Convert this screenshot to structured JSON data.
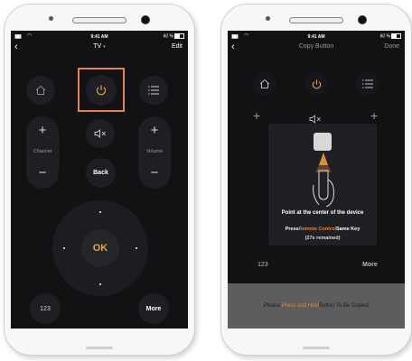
{
  "status_bar": {
    "time": "9:41 AM",
    "battery": "60 %"
  },
  "left_screen": {
    "nav": {
      "back_icon": "chevron-left-icon",
      "title": "TV",
      "title_caret": "▾",
      "right": "Edit"
    },
    "buttons": {
      "home_icon": "home-icon",
      "power_icon": "power-icon",
      "menu_icon": "menu-list-icon",
      "channel_label": "Channel",
      "volume_label": "Volume",
      "mute_icon": "mute-icon",
      "back_label": "Back",
      "ok_label": "OK",
      "numpad_label": "123",
      "more_label": "More"
    },
    "highlight_color": "#e8853a"
  },
  "right_screen": {
    "nav": {
      "back_icon": "chevron-left-icon",
      "title": "Copy Button",
      "right": "Done"
    },
    "popup": {
      "line1": "Point at the center of the device",
      "line2_pre": "Press",
      "line2_highlight": "Remote Control",
      "line2_post": "Same Key",
      "line3": "(27s remained)"
    },
    "background_labels": {
      "numpad": "123",
      "more": "More"
    },
    "banner": {
      "pre": "Please ",
      "highlight": "Press and Hold",
      "post": "Button To Be Copied"
    }
  },
  "colors": {
    "accent": "#e8853a",
    "screen_bg": "#111214",
    "button_bg": "#1e1f22"
  }
}
